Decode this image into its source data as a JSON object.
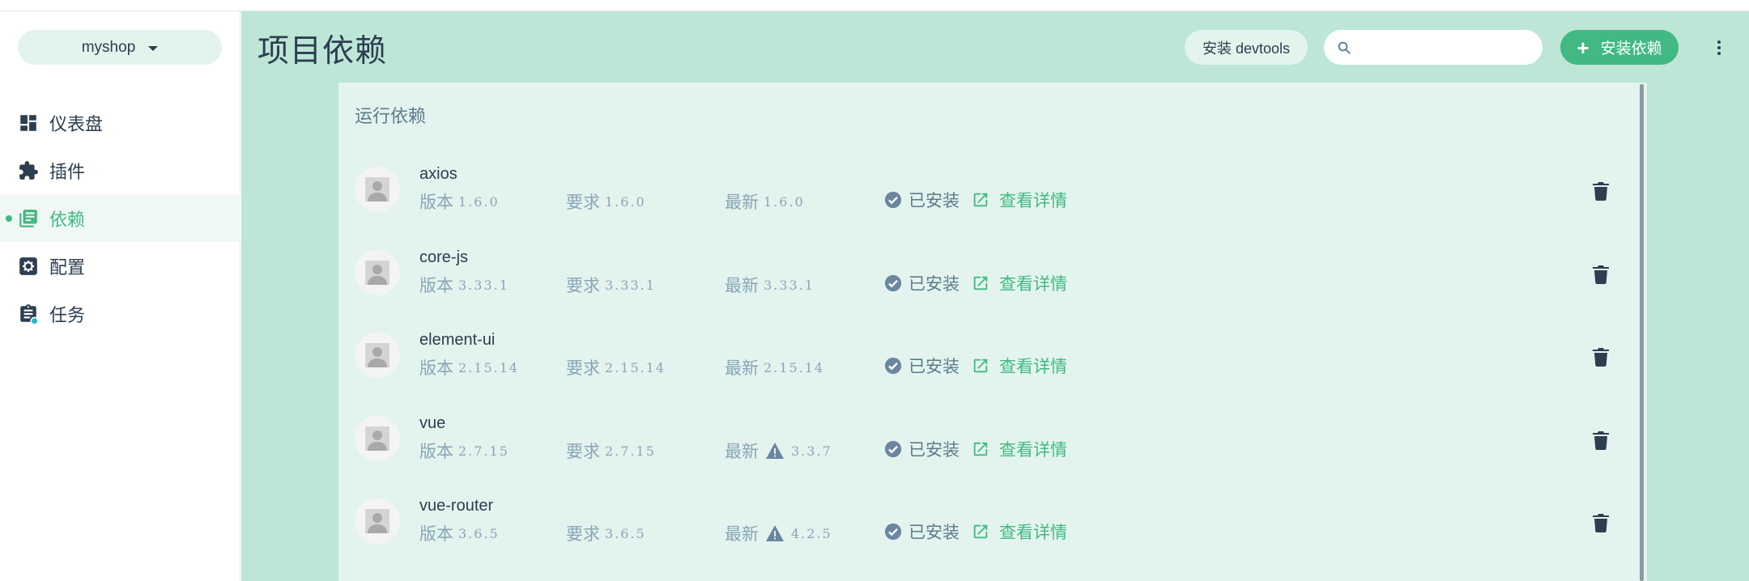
{
  "project": {
    "name": "myshop"
  },
  "nav": {
    "items": [
      {
        "key": "dashboard",
        "label": "仪表盘",
        "icon": "dashboard-icon",
        "active": false
      },
      {
        "key": "plugins",
        "label": "插件",
        "icon": "puzzle-icon",
        "active": false
      },
      {
        "key": "dependencies",
        "label": "依赖",
        "icon": "library-icon",
        "active": true
      },
      {
        "key": "config",
        "label": "配置",
        "icon": "settings-icon",
        "active": false
      },
      {
        "key": "tasks",
        "label": "任务",
        "icon": "clipboard-icon",
        "active": false
      }
    ]
  },
  "header": {
    "title": "项目依赖",
    "devtools_label": "安装 devtools",
    "search_placeholder": "",
    "install_label": "安装依赖"
  },
  "section": {
    "title": "运行依赖"
  },
  "labels": {
    "version": "版本",
    "wanted": "要求",
    "latest": "最新",
    "installed": "已安装",
    "details": "查看详情"
  },
  "dependencies": [
    {
      "name": "axios",
      "version": "1.6.0",
      "wanted": "1.6.0",
      "latest": "1.6.0",
      "outdated": false
    },
    {
      "name": "core-js",
      "version": "3.33.1",
      "wanted": "3.33.1",
      "latest": "3.33.1",
      "outdated": false
    },
    {
      "name": "element-ui",
      "version": "2.15.14",
      "wanted": "2.15.14",
      "latest": "2.15.14",
      "outdated": false
    },
    {
      "name": "vue",
      "version": "2.7.15",
      "wanted": "2.7.15",
      "latest": "3.3.7",
      "outdated": true
    },
    {
      "name": "vue-router",
      "version": "3.6.5",
      "wanted": "3.6.5",
      "latest": "4.2.5",
      "outdated": true
    }
  ],
  "colors": {
    "accent": "#42b983",
    "main_bg": "#bde6d7",
    "panel_bg": "#e3f4ee",
    "text": "#2c3e50",
    "muted": "#8aa5b8",
    "status": "#5d7b8e"
  }
}
